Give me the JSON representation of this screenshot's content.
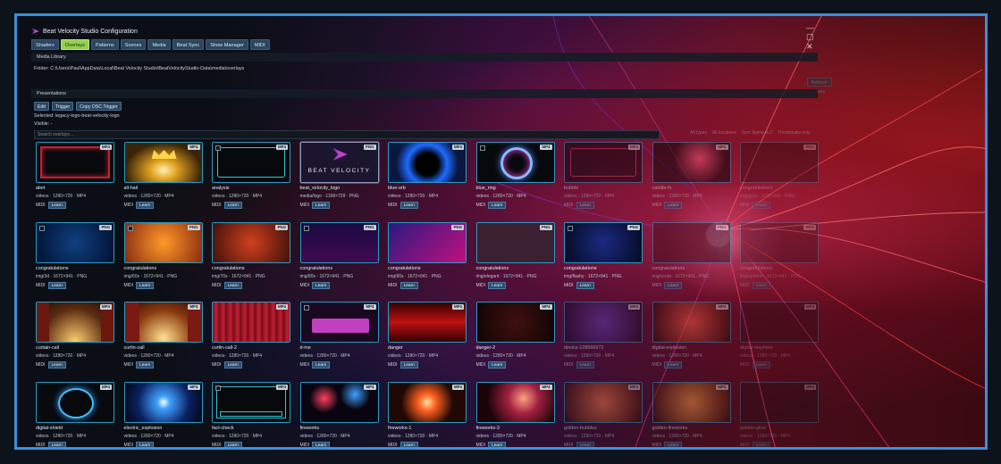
{
  "window": {
    "title": "Beat Velocity Studio Configuration",
    "controls": "— ▢ ✕"
  },
  "tabs": [
    "Shaders",
    "Overlays",
    "Patterns",
    "Scenes",
    "Media",
    "Beat Sync",
    "Show Manager",
    "MIDI"
  ],
  "active_tab": "Overlays",
  "media_library": {
    "header": "Media Library",
    "folder_label": "Folder:",
    "folder_path": "C:\\Users\\Paul\\AppData\\Local\\Beat Velocity Studio\\BeatVelocityStudio-Data\\media\\overlays",
    "browse_label": "Refresh Library"
  },
  "presentations": {
    "header": "Presentations",
    "buttons": [
      "Edit",
      "Trigger",
      "Copy OSC Trigger"
    ],
    "selected_label": "Selected:",
    "selected_value": "legacy-logo-beat-velocity-logo",
    "visible_label": "Visible:",
    "visible_value": "-"
  },
  "search": {
    "placeholder": "Search overlays..."
  },
  "filters": [
    "All types",
    "All locations",
    "Sort: Name A-Z",
    "Thumbnails only"
  ],
  "midi_label": "MIDI",
  "learn_label": "Learn",
  "items": [
    {
      "name": "alert",
      "meta": "videos · 1280×720 · MP4",
      "badge": "MP4",
      "style": "frame",
      "checkbox": false
    },
    {
      "name": "all-hail",
      "meta": "videos · 1280×720 · MP4",
      "badge": "MP4",
      "style": "crown",
      "checkbox": false
    },
    {
      "name": "analysis",
      "meta": "videos · 1280×720 · MP4",
      "badge": "MP4",
      "style": "hud",
      "checkbox": true
    },
    {
      "name": "beat_velocity_logo",
      "meta": "media/logo · 1168×729 · PNG",
      "badge": "PNG",
      "style": "logo",
      "checkbox": false,
      "selected": true,
      "logo_text": "BEAT VELOCITY"
    },
    {
      "name": "blue-orb",
      "meta": "videos · 1280×720 · MP4",
      "badge": "MP4",
      "style": "orb",
      "checkbox": false
    },
    {
      "name": "blue_ring",
      "meta": "videos · 1280×720 · MP4",
      "badge": "MP4",
      "style": "ring",
      "checkbox": true
    },
    {
      "name": "bubble",
      "meta": "videos · 1280×720 · MP4",
      "badge": "MP4",
      "style": "bubbles",
      "checkbox": false,
      "fade": 1
    },
    {
      "name": "candle-fx",
      "meta": "videos · 1280×720 · MP4",
      "badge": "MP4",
      "style": "sparks",
      "checkbox": false,
      "fade": 1
    },
    {
      "name": "congratulations",
      "meta": "img/gold · 1672×941 · PNG",
      "badge": "PNG",
      "style": "congrats-plain",
      "checkbox": false,
      "fade": 2
    },
    {
      "name": "congratulations",
      "meta": "img/3d · 1672×941 · PNG",
      "badge": "PNG",
      "style": "c-blue",
      "checkbox": true
    },
    {
      "name": "congratulations",
      "meta": "img/60s · 1672×941 · PNG",
      "badge": "PNG",
      "style": "c-orange",
      "checkbox": true
    },
    {
      "name": "congratulations",
      "meta": "img/70s · 1672×941 · PNG",
      "badge": "PNG",
      "style": "c-red",
      "checkbox": false
    },
    {
      "name": "congratulations",
      "meta": "img/80s · 1672×941 · PNG",
      "badge": "PNG",
      "style": "c-neon",
      "checkbox": true
    },
    {
      "name": "congratulations",
      "meta": "img/90s · 1672×941 · PNG",
      "badge": "PNG",
      "style": "c-pink",
      "checkbox": false
    },
    {
      "name": "congratulations",
      "meta": "img/elegant · 1672×941 · PNG",
      "badge": "PNG",
      "style": "c-elegant",
      "checkbox": false
    },
    {
      "name": "congratulations",
      "meta": "img/flashy · 1672×941 · PNG",
      "badge": "PNG",
      "style": "c-flashy",
      "checkbox": true
    },
    {
      "name": "congratulations",
      "meta": "img/script · 1672×941 · PNG",
      "badge": "PNG",
      "style": "c-script",
      "checkbox": false,
      "fade": 1
    },
    {
      "name": "congratulations",
      "meta": "img/sparkle · 1672×941 · PNG",
      "badge": "PNG",
      "style": "c-faint",
      "checkbox": false,
      "fade": 2
    },
    {
      "name": "curtain-call",
      "meta": "videos · 1280×720 · MP4",
      "badge": "MP4",
      "style": "curtain-gold",
      "checkbox": false
    },
    {
      "name": "curtin-call",
      "meta": "videos · 1280×720 · MP4",
      "badge": "MP4",
      "style": "curtain-gold2",
      "checkbox": false
    },
    {
      "name": "curtin-call-2",
      "meta": "videos · 1280×720 · MP4",
      "badge": "MP4",
      "style": "curtain-red",
      "checkbox": false
    },
    {
      "name": "d-me",
      "meta": "videos · 1280×720 · MP4",
      "badge": "MP4",
      "style": "dme",
      "checkbox": true
    },
    {
      "name": "danger",
      "meta": "videos · 1280×720 · MP4",
      "badge": "MP4",
      "style": "danger",
      "checkbox": false
    },
    {
      "name": "danger-2",
      "meta": "videos · 1280×720 · MP4",
      "badge": "MP4",
      "style": "danger2",
      "checkbox": false
    },
    {
      "name": "device-128566972",
      "meta": "videos · 1280×720 · MP4",
      "badge": "MP4",
      "style": "vortex",
      "checkbox": false,
      "fade": 1
    },
    {
      "name": "digital-explosion",
      "meta": "videos · 1280×720 · MP4",
      "badge": "MP4",
      "style": "glow",
      "checkbox": false,
      "fade": 1
    },
    {
      "name": "digital-mayhem",
      "meta": "videos · 1280×720 · MP4",
      "badge": "MP4",
      "style": "dark",
      "checkbox": false,
      "fade": 2
    },
    {
      "name": "digital-shield",
      "meta": "videos · 1280×720 · MP4",
      "badge": "MP4",
      "style": "shield",
      "checkbox": false
    },
    {
      "name": "electric_explosion",
      "meta": "videos · 1280×720 · MP4",
      "badge": "MP4",
      "style": "electric",
      "checkbox": false
    },
    {
      "name": "fact-check",
      "meta": "videos · 1280×720 · MP4",
      "badge": "MP4",
      "style": "hud2",
      "checkbox": true
    },
    {
      "name": "fireworks",
      "meta": "videos · 1280×720 · MP4",
      "badge": "MP4",
      "style": "fireworks",
      "checkbox": false
    },
    {
      "name": "fireworks-1",
      "meta": "videos · 1280×720 · MP4",
      "badge": "MP4",
      "style": "fw1",
      "checkbox": false
    },
    {
      "name": "fireworks-3",
      "meta": "videos · 1280×720 · MP4",
      "badge": "MP4",
      "style": "fw3",
      "checkbox": false
    },
    {
      "name": "golden-bubbles",
      "meta": "videos · 1280×720 · MP4",
      "badge": "MP4",
      "style": "gbubbles",
      "checkbox": false,
      "fade": 1
    },
    {
      "name": "golden-fireworks",
      "meta": "videos · 1280×720 · MP4",
      "badge": "MP4",
      "style": "gfw",
      "checkbox": false,
      "fade": 1
    },
    {
      "name": "golden-glow",
      "meta": "videos · 1280×720 · MP4",
      "badge": "MP4",
      "style": "dark",
      "checkbox": false,
      "fade": 2
    }
  ],
  "colors": {
    "accent": "#3b8ede",
    "active_tab": "#92d14f",
    "thumb_border": "#2a9cc4"
  }
}
